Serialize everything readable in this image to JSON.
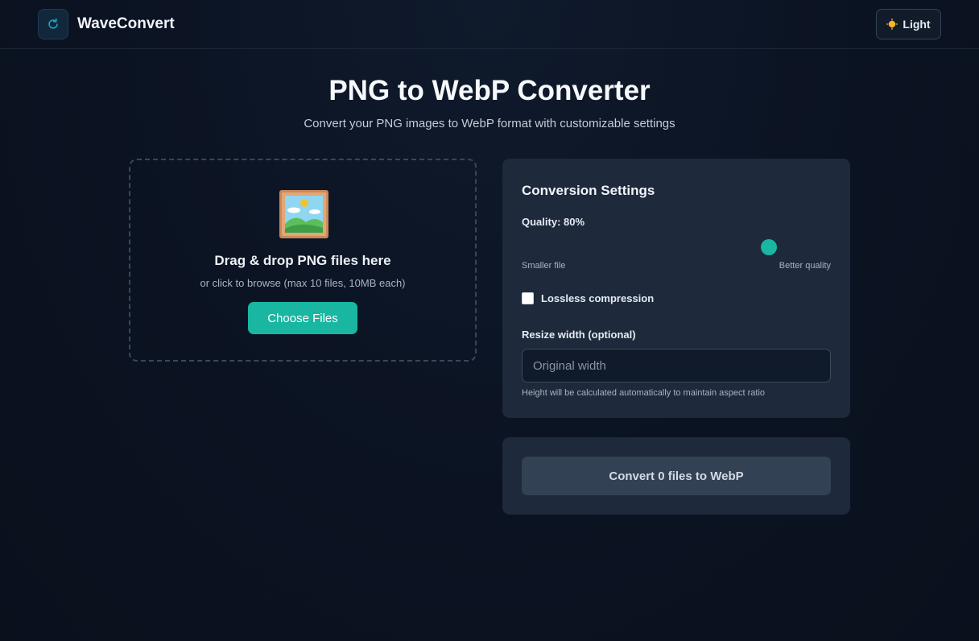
{
  "header": {
    "brand": "WaveConvert",
    "logo_icon": "refresh-icon",
    "theme_button": {
      "icon": "sun-icon",
      "label": "Light"
    }
  },
  "hero": {
    "title": "PNG to WebP Converter",
    "subtitle": "Convert your PNG images to WebP format with customizable settings"
  },
  "upload": {
    "icon": "framed-picture-icon",
    "title": "Drag & drop PNG files here",
    "subtitle": "or click to browse (max 10 files, 10MB each)",
    "button_label": "Choose Files"
  },
  "settings": {
    "title": "Conversion Settings",
    "quality_label": "Quality: 80%",
    "quality_value": 80,
    "range_min_label": "Smaller file",
    "range_max_label": "Better quality",
    "lossless_label": "Lossless compression",
    "lossless_checked": false,
    "resize_label": "Resize width (optional)",
    "resize_placeholder": "Original width",
    "resize_value": "",
    "resize_help": "Height will be calculated automatically to maintain aspect ratio"
  },
  "convert": {
    "button_label": "Convert 0 files to WebP"
  },
  "colors": {
    "accent": "#19b6a2",
    "panel": "#1e293b",
    "background": "#0b1322",
    "button_disabled": "#334155"
  }
}
